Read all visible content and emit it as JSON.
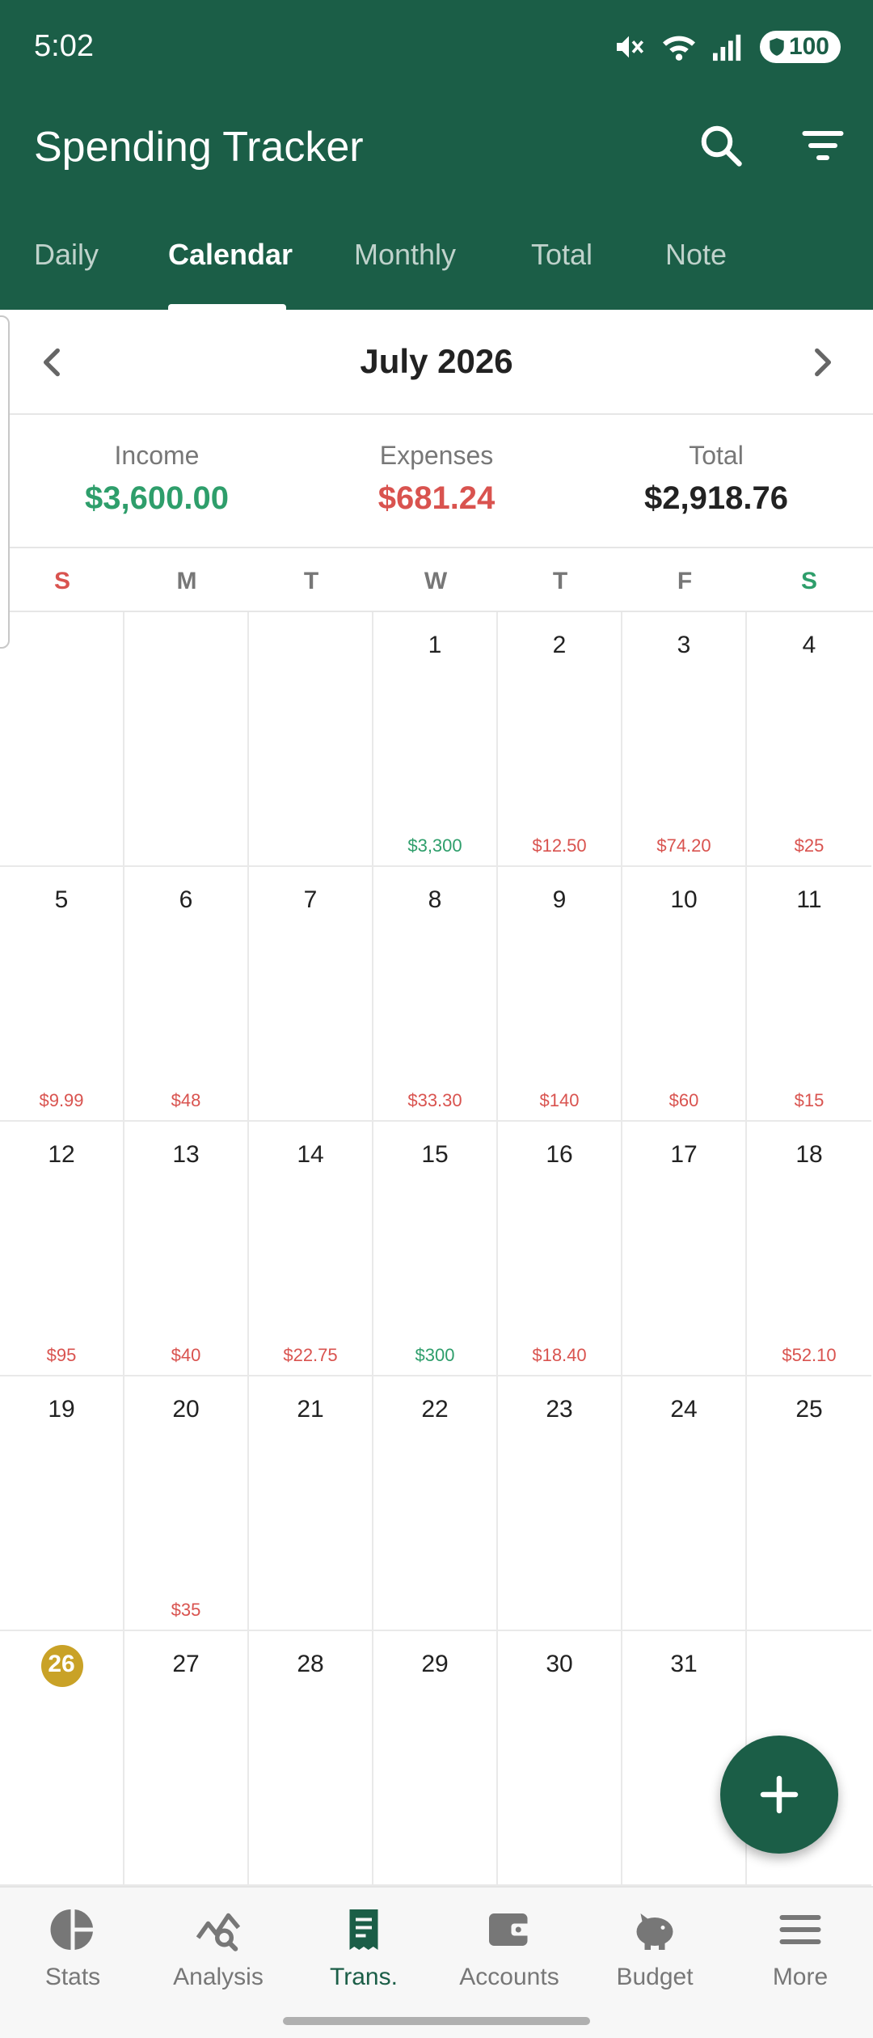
{
  "status_bar": {
    "time": "5:02",
    "battery": "100"
  },
  "app": {
    "title": "Spending Tracker"
  },
  "tabs": [
    {
      "label": "Daily"
    },
    {
      "label": "Calendar"
    },
    {
      "label": "Monthly"
    },
    {
      "label": "Total"
    },
    {
      "label": "Note"
    }
  ],
  "active_tab": "Calendar",
  "month": {
    "label": "July 2026"
  },
  "summary": {
    "income_label": "Income",
    "income_value": "$3,600.00",
    "expenses_label": "Expenses",
    "expenses_value": "$681.24",
    "total_label": "Total",
    "total_value": "$2,918.76"
  },
  "weekdays": [
    "S",
    "M",
    "T",
    "W",
    "T",
    "F",
    "S"
  ],
  "colors": {
    "primary": "#1b5e47",
    "income": "#2e9e6b",
    "expense": "#d9534f",
    "today": "#c9a227",
    "sunday": "#d9534f",
    "saturday": "#2e9e6b"
  },
  "calendar": {
    "today": "26",
    "weeks": [
      [
        {
          "day": "",
          "amount": ""
        },
        {
          "day": "",
          "amount": ""
        },
        {
          "day": "",
          "amount": ""
        },
        {
          "day": "1",
          "amount": "$3,300",
          "type": "income"
        },
        {
          "day": "2",
          "amount": "$12.50",
          "type": "expense"
        },
        {
          "day": "3",
          "amount": "$74.20",
          "type": "expense"
        },
        {
          "day": "4",
          "amount": "$25",
          "type": "expense"
        }
      ],
      [
        {
          "day": "5",
          "amount": "$9.99",
          "type": "expense"
        },
        {
          "day": "6",
          "amount": "$48",
          "type": "expense"
        },
        {
          "day": "7",
          "amount": ""
        },
        {
          "day": "8",
          "amount": "$33.30",
          "type": "expense"
        },
        {
          "day": "9",
          "amount": "$140",
          "type": "expense"
        },
        {
          "day": "10",
          "amount": "$60",
          "type": "expense"
        },
        {
          "day": "11",
          "amount": "$15",
          "type": "expense"
        }
      ],
      [
        {
          "day": "12",
          "amount": "$95",
          "type": "expense"
        },
        {
          "day": "13",
          "amount": "$40",
          "type": "expense"
        },
        {
          "day": "14",
          "amount": "$22.75",
          "type": "expense"
        },
        {
          "day": "15",
          "amount": "$300",
          "type": "income"
        },
        {
          "day": "16",
          "amount": "$18.40",
          "type": "expense"
        },
        {
          "day": "17",
          "amount": ""
        },
        {
          "day": "18",
          "amount": "$52.10",
          "type": "expense"
        }
      ],
      [
        {
          "day": "19",
          "amount": ""
        },
        {
          "day": "20",
          "amount": "$35",
          "type": "expense"
        },
        {
          "day": "21",
          "amount": ""
        },
        {
          "day": "22",
          "amount": ""
        },
        {
          "day": "23",
          "amount": ""
        },
        {
          "day": "24",
          "amount": ""
        },
        {
          "day": "25",
          "amount": ""
        }
      ],
      [
        {
          "day": "26",
          "amount": ""
        },
        {
          "day": "27",
          "amount": ""
        },
        {
          "day": "28",
          "amount": ""
        },
        {
          "day": "29",
          "amount": ""
        },
        {
          "day": "30",
          "amount": ""
        },
        {
          "day": "31",
          "amount": ""
        },
        {
          "day": "",
          "amount": ""
        }
      ]
    ]
  },
  "bottom_nav": [
    {
      "label": "Stats",
      "icon": "pie-chart-icon"
    },
    {
      "label": "Analysis",
      "icon": "analysis-icon"
    },
    {
      "label": "Trans.",
      "icon": "receipt-icon"
    },
    {
      "label": "Accounts",
      "icon": "wallet-icon"
    },
    {
      "label": "Budget",
      "icon": "piggy-bank-icon"
    },
    {
      "label": "More",
      "icon": "menu-icon"
    }
  ],
  "active_nav": "Trans."
}
